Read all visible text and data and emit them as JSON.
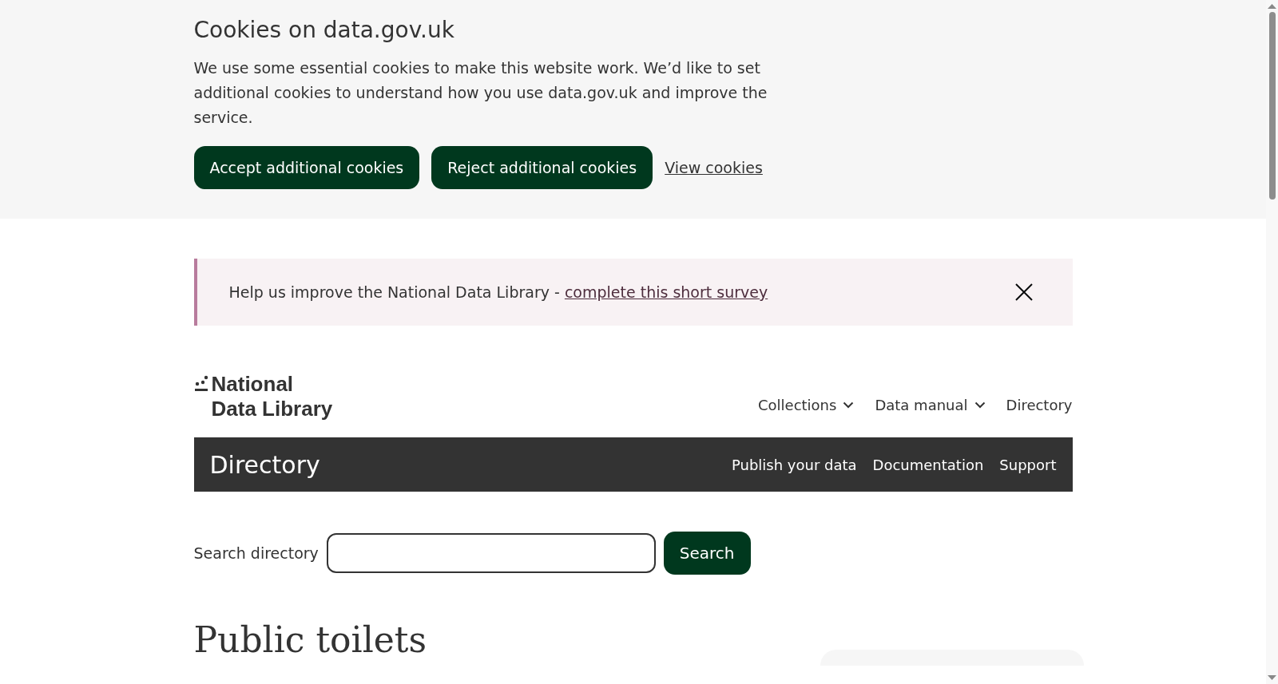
{
  "cookie_banner": {
    "title": "Cookies on data.gov.uk",
    "text": "We use some essential cookies to make this website work. We’d like to set additional cookies to understand how you use data.gov.uk and improve the service.",
    "buttons": [
      "Accept additional cookies",
      "Reject additional cookies"
    ],
    "link": "View cookies"
  },
  "survey_banner": {
    "text": "Help us improve the National Data Library - ",
    "link": "complete this short survey"
  },
  "logo": {
    "lines": [
      "National",
      "Data Library"
    ]
  },
  "nav": [
    {
      "label": "Collections",
      "kind": "dropdown"
    },
    {
      "label": "Data manual",
      "kind": "dropdown"
    },
    {
      "label": "Directory",
      "kind": "link"
    }
  ],
  "service_bar": {
    "title": "Directory",
    "links": [
      "Publish your data",
      "Documentation",
      "Support"
    ]
  },
  "search": {
    "label": "Search directory",
    "button": "Search"
  },
  "page_title": "Public toilets"
}
